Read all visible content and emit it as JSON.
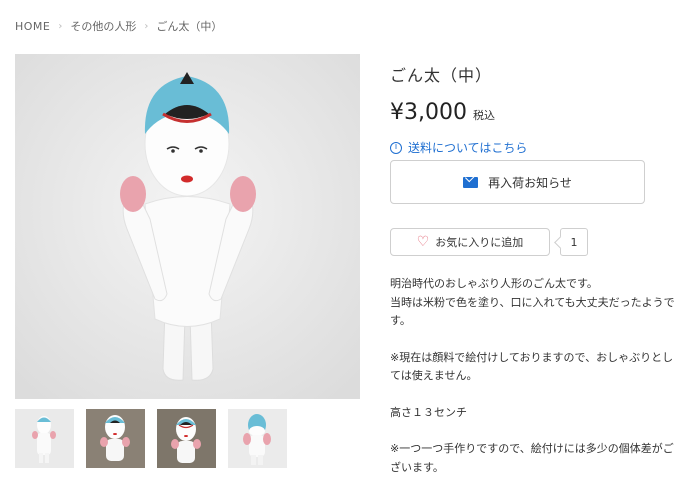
{
  "breadcrumb": {
    "home": "HOME",
    "category": "その他の人形",
    "current": "ごん太（中）"
  },
  "product": {
    "title": "ごん太（中）",
    "price": "¥3,000",
    "tax_label": "税込",
    "shipping_link": "送料についてはこちら",
    "restock_button": "再入荷お知らせ",
    "favorite_button": "お気に入りに追加",
    "favorite_count": "1",
    "description": {
      "line1": "明治時代のおしゃぶり人形のごん太です。",
      "line2": "当時は米粉で色を塗り、口に入れても大丈夫だったようです。",
      "line3": "※現在は顔料で絵付けしておりますので、おしゃぶりとしては使えません。",
      "line4": "高さ１３センチ",
      "line5": "※一つ一つ手作りですので、絵付けには多少の個体差がございます。"
    }
  },
  "icons": {
    "info": "info-icon",
    "mail": "mail-icon",
    "heart": "heart-icon",
    "chevron": "chevron-right-icon"
  },
  "colors": {
    "accent": "#1f6fd1",
    "heart": "#e05b6b"
  }
}
